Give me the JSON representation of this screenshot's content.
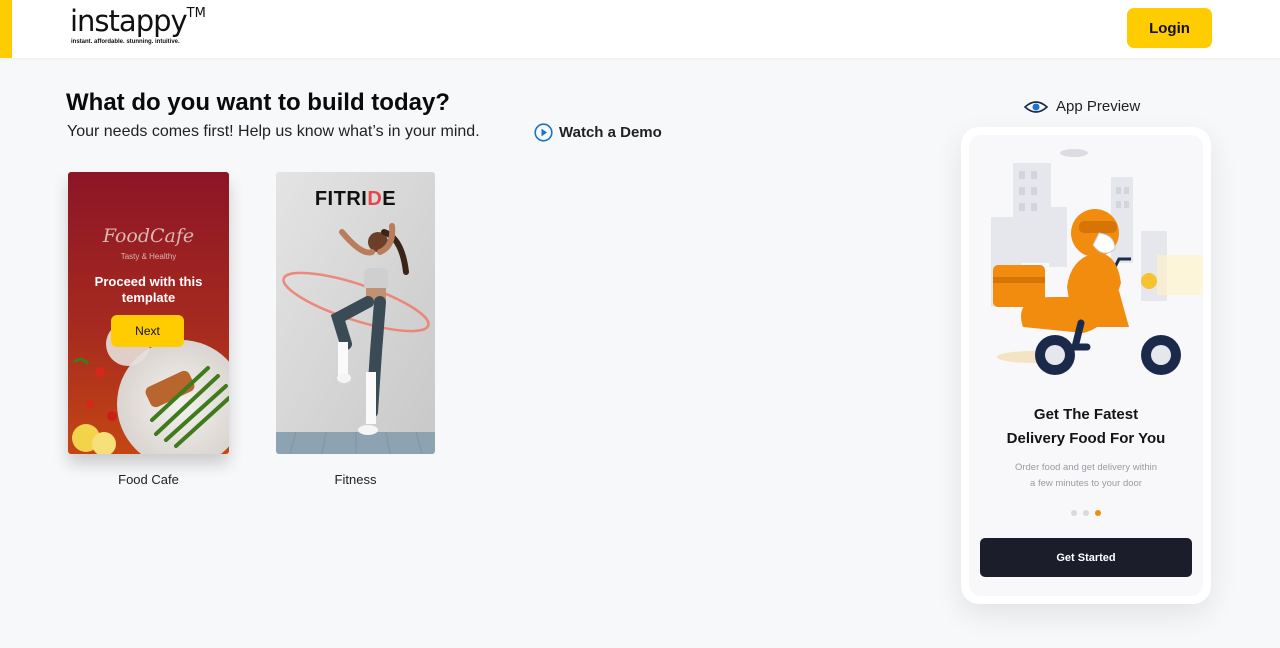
{
  "header": {
    "logo_text": "instappy",
    "logo_tm": "TM",
    "logo_tagline": "instant. affordable. stunning. intuitive.",
    "login_label": "Login"
  },
  "main": {
    "title": "What do you want to build today?",
    "subtitle": "Your needs comes first! Help us know what’s in your mind.",
    "demo_label": "Watch a Demo"
  },
  "templates": [
    {
      "name": "Food Cafe",
      "brand": "FoodCafe",
      "brand_tagline": "Tasty & Healthy",
      "overlay_text": "Proceed with this template",
      "next_label": "Next"
    },
    {
      "name": "Fitness",
      "brand_parts": [
        "FITRI",
        "D",
        "E"
      ]
    }
  ],
  "preview": {
    "label": "App Preview",
    "heading_line1": "Get The Fatest",
    "heading_line2": "Delivery Food For You",
    "body_line1": "Order food and get delivery within",
    "body_line2": "a few minutes to your door",
    "dots_active_index": 2,
    "cta_label": "Get Started"
  },
  "colors": {
    "accent": "#ffcc00",
    "cta_dark": "#1b1d2a",
    "dot_active": "#f28c0f",
    "fitride_highlight": "#e8454a",
    "demo_icon": "#1a73c8"
  }
}
